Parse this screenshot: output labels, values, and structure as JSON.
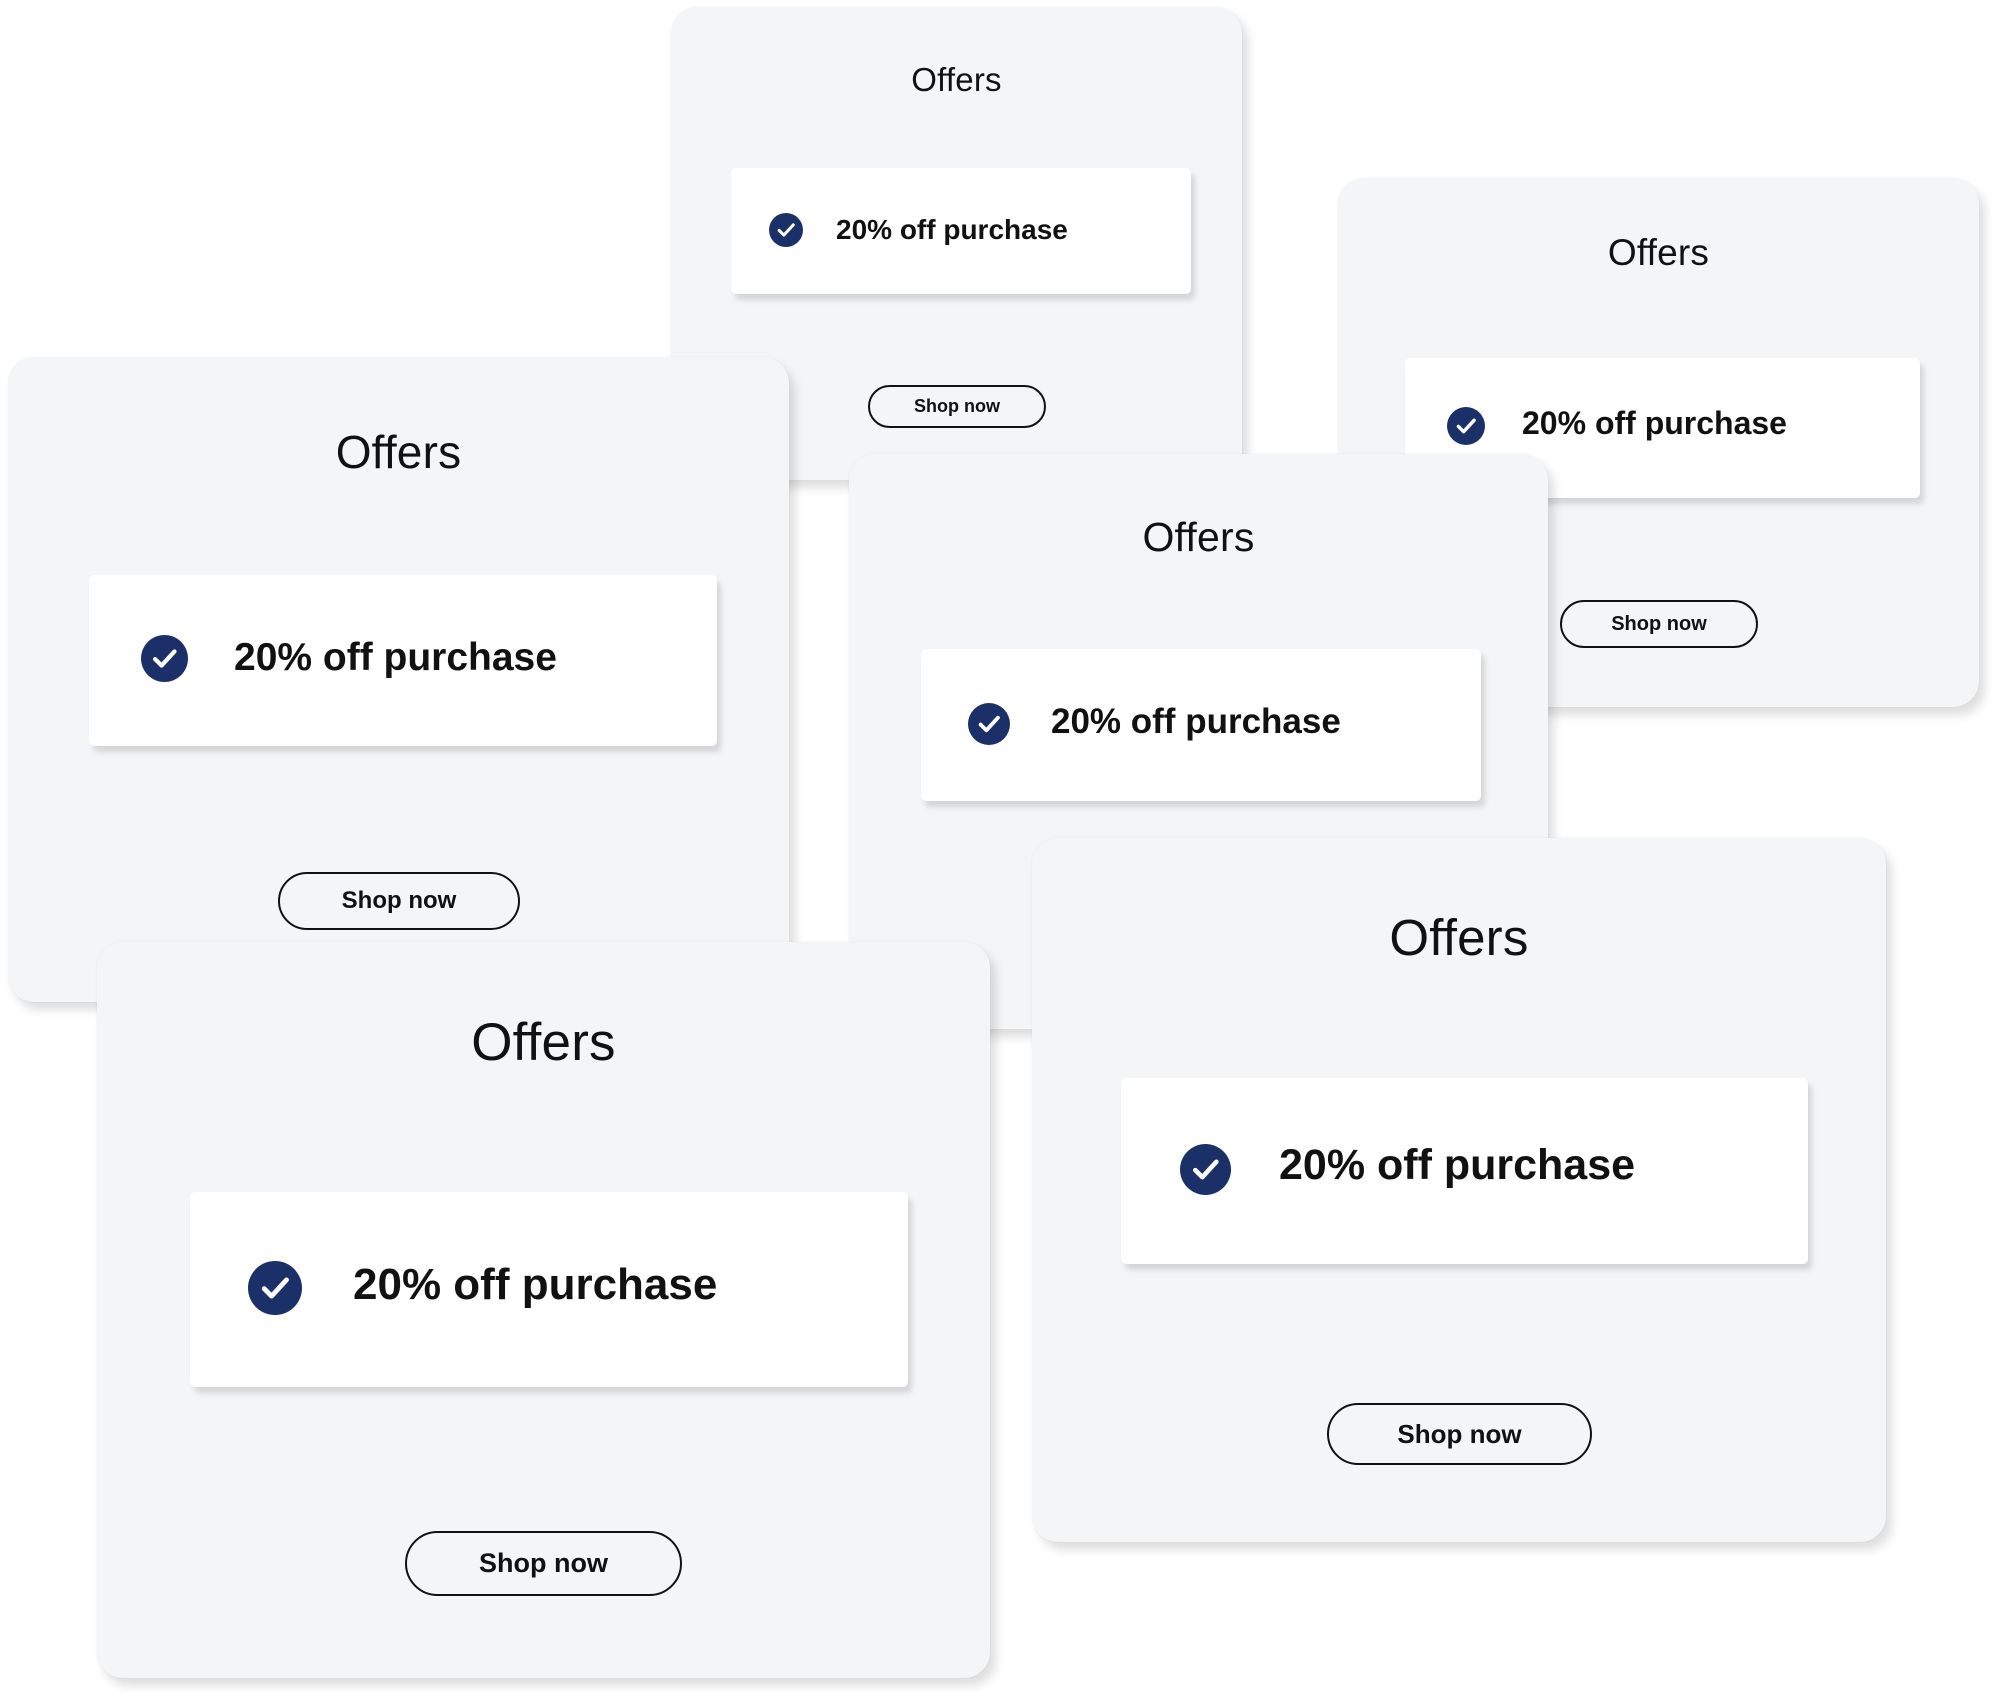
{
  "colors": {
    "background": "#ffffff",
    "card": "#f4f5f7",
    "offer_box": "#ffffff",
    "check_badge": "#1b3068",
    "text": "#111111"
  },
  "icons": {
    "offer_check": "check-circle-icon"
  },
  "cards": [
    {
      "title": "Offers",
      "offer": "20% off purchase",
      "button": "Shop now"
    },
    {
      "title": "Offers",
      "offer": "20% off purchase",
      "button": "Shop now"
    },
    {
      "title": "Offers",
      "offer": "20% off purchase",
      "button": "Shop now"
    },
    {
      "title": "Offers",
      "offer": "20% off purchase"
    },
    {
      "title": "Offers",
      "offer": "20% off purchase",
      "button": "Shop now"
    },
    {
      "title": "Offers",
      "offer": "20% off purchase",
      "button": "Shop now"
    }
  ]
}
